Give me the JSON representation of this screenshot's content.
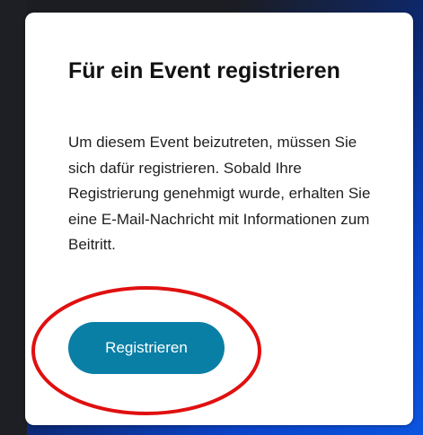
{
  "dialog": {
    "title": "Für ein Event registrieren",
    "message": "Um diesem Event beizutreten, müssen Sie sich dafür registrieren. Sobald Ihre Registrierung genehmigt wurde, erhalten Sie eine E-Mail-Nachricht mit Informationen zum Beitritt.",
    "register_button_label": "Registrieren"
  },
  "colors": {
    "button_background": "#0a7fa6",
    "annotation_ring": "#e01010",
    "card_background": "#ffffff"
  }
}
